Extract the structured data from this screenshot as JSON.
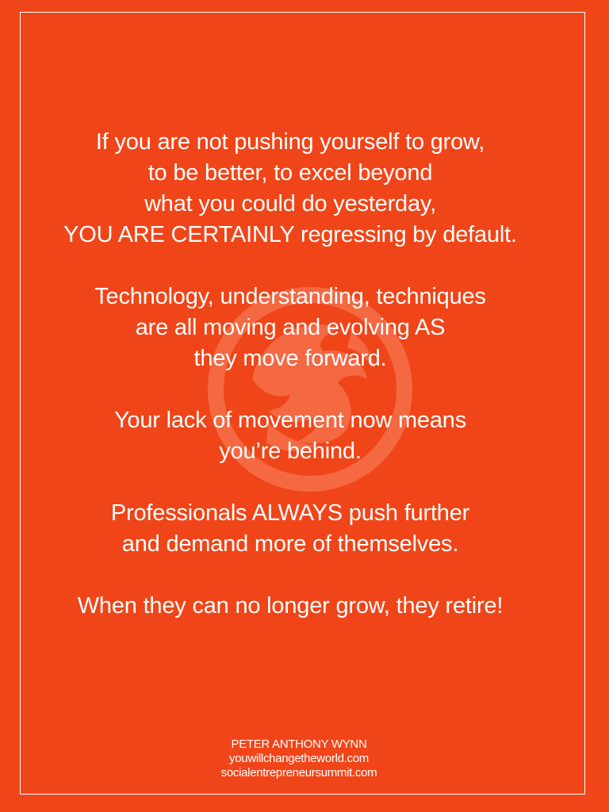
{
  "colors": {
    "background": "#f04518",
    "text": "#ffffff",
    "frame": "#ffffff"
  },
  "watermark": {
    "icon": "dragon-emblem-icon"
  },
  "quote": {
    "paragraphs": [
      {
        "lines": [
          "If you are not pushing yourself to grow,",
          "to be better, to excel beyond",
          "what you could do yesterday,",
          "YOU ARE CERTAINLY regressing by default."
        ]
      },
      {
        "lines": [
          "Technology, understanding, techniques",
          "are all moving and evolving AS",
          "they move forward."
        ]
      },
      {
        "lines": [
          "Your lack of movement now means",
          "you’re behind."
        ]
      },
      {
        "lines": [
          "Professionals ALWAYS push further",
          "and demand more of themselves."
        ]
      },
      {
        "lines": [
          "When they can no longer grow, they retire!"
        ]
      }
    ]
  },
  "credit": {
    "author": "PETER ANTHONY WYNN",
    "website1": "youwillchangetheworld.com",
    "website2": "socialentrepreneursummit.com"
  }
}
